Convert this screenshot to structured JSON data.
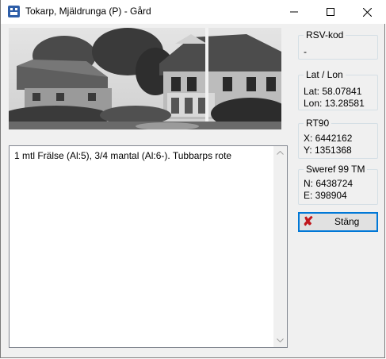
{
  "window": {
    "title": "Tokarp, Mjäldrunga (P) - Gård",
    "icon": "app-icon"
  },
  "titlebar_buttons": {
    "minimize_icon": "minimize-icon",
    "maximize_icon": "maximize-icon",
    "close_icon": "close-icon"
  },
  "photo": {
    "description_icon": "farmhouse-photo"
  },
  "notes": {
    "text": "1 mtl Frälse (Al:5),  3/4 mantal (Al:6-). Tubbarps rote"
  },
  "groups": {
    "rsv": {
      "title": "RSV-kod",
      "value": "-"
    },
    "latlon": {
      "title": "Lat / Lon",
      "lat": "Lat: 58.07841",
      "lon": "Lon: 13.28581"
    },
    "rt90": {
      "title": "RT90",
      "x": "X: 6442162",
      "y": "Y: 1351368"
    },
    "sweref": {
      "title": "Sweref 99 TM",
      "n": "N: 6438724",
      "e": "E: 398904"
    }
  },
  "close_button": {
    "label": "Stäng",
    "icon": "red-x-icon"
  },
  "colors": {
    "focus_border": "#0078d7",
    "icon_red": "#c0161c",
    "app_icon_blue": "#2e5ea8"
  }
}
